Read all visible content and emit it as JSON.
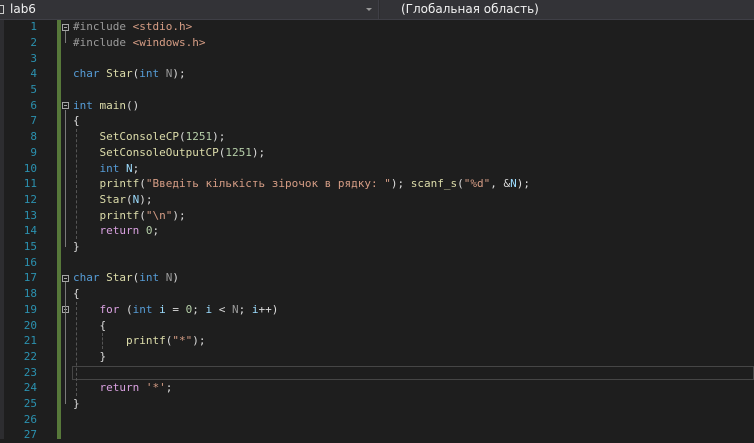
{
  "toolbar": {
    "file_combo": "lab6",
    "scope_combo": "(Глобальная область)"
  },
  "colors": {
    "kw": "#569cd6",
    "fn": "#dcdcaa",
    "str": "#d69d85",
    "pp": "#9b9b9b",
    "param": "#9a9a9a",
    "var": "#9cdcfe",
    "ctl": "#d8a0df",
    "num": "#b5cea8",
    "def": "#dcdcdc",
    "linenum": "#2b91af",
    "changebar": "#57783a"
  },
  "editor": {
    "current_line": 23,
    "fold_lines": [
      1,
      6,
      17,
      19
    ],
    "lines": [
      [
        [
          "pp",
          "#include "
        ],
        [
          "str",
          "<stdio.h>"
        ]
      ],
      [
        [
          "pp",
          "#include "
        ],
        [
          "str",
          "<windows.h>"
        ]
      ],
      [],
      [
        [
          "kw",
          "char "
        ],
        [
          "fn",
          "Star"
        ],
        [
          "def",
          "("
        ],
        [
          "kw",
          "int "
        ],
        [
          "param",
          "N"
        ],
        [
          "def",
          ");"
        ]
      ],
      [],
      [
        [
          "kw",
          "int "
        ],
        [
          "fn",
          "main"
        ],
        [
          "def",
          "()"
        ]
      ],
      [
        [
          "def",
          "{"
        ]
      ],
      [
        [
          "def",
          "    "
        ],
        [
          "fn",
          "SetConsoleCP"
        ],
        [
          "def",
          "("
        ],
        [
          "num",
          "1251"
        ],
        [
          "def",
          ");"
        ]
      ],
      [
        [
          "def",
          "    "
        ],
        [
          "fn",
          "SetConsoleOutputCP"
        ],
        [
          "def",
          "("
        ],
        [
          "num",
          "1251"
        ],
        [
          "def",
          ");"
        ]
      ],
      [
        [
          "def",
          "    "
        ],
        [
          "kw",
          "int "
        ],
        [
          "var",
          "N"
        ],
        [
          "def",
          ";"
        ]
      ],
      [
        [
          "def",
          "    "
        ],
        [
          "fn",
          "printf"
        ],
        [
          "def",
          "("
        ],
        [
          "str",
          "\"Введіть кількість зірочок в рядку: \""
        ],
        [
          "def",
          "); "
        ],
        [
          "fn",
          "scanf_s"
        ],
        [
          "def",
          "("
        ],
        [
          "str",
          "\"%d\""
        ],
        [
          "def",
          ", &"
        ],
        [
          "var",
          "N"
        ],
        [
          "def",
          ");"
        ]
      ],
      [
        [
          "def",
          "    "
        ],
        [
          "fn",
          "Star"
        ],
        [
          "def",
          "("
        ],
        [
          "var",
          "N"
        ],
        [
          "def",
          ");"
        ]
      ],
      [
        [
          "def",
          "    "
        ],
        [
          "fn",
          "printf"
        ],
        [
          "def",
          "("
        ],
        [
          "str",
          "\"\\n\""
        ],
        [
          "def",
          ");"
        ]
      ],
      [
        [
          "def",
          "    "
        ],
        [
          "ctl",
          "return "
        ],
        [
          "num",
          "0"
        ],
        [
          "def",
          ";"
        ]
      ],
      [
        [
          "def",
          "}"
        ]
      ],
      [],
      [
        [
          "kw",
          "char "
        ],
        [
          "fn",
          "Star"
        ],
        [
          "def",
          "("
        ],
        [
          "kw",
          "int "
        ],
        [
          "param",
          "N"
        ],
        [
          "def",
          ")"
        ]
      ],
      [
        [
          "def",
          "{"
        ]
      ],
      [
        [
          "def",
          "    "
        ],
        [
          "ctl",
          "for "
        ],
        [
          "def",
          "("
        ],
        [
          "kw",
          "int "
        ],
        [
          "var",
          "i"
        ],
        [
          "def",
          " = "
        ],
        [
          "num",
          "0"
        ],
        [
          "def",
          "; "
        ],
        [
          "var",
          "i"
        ],
        [
          "def",
          " < "
        ],
        [
          "param",
          "N"
        ],
        [
          "def",
          "; "
        ],
        [
          "var",
          "i"
        ],
        [
          "def",
          "++)"
        ]
      ],
      [
        [
          "def",
          "    {"
        ]
      ],
      [
        [
          "def",
          "        "
        ],
        [
          "fn",
          "printf"
        ],
        [
          "def",
          "("
        ],
        [
          "str",
          "\"*\""
        ],
        [
          "def",
          ");"
        ]
      ],
      [
        [
          "def",
          "    }"
        ]
      ],
      [],
      [
        [
          "def",
          "    "
        ],
        [
          "ctl",
          "return "
        ],
        [
          "str",
          "'*'"
        ],
        [
          "def",
          ";"
        ]
      ],
      [
        [
          "def",
          "}"
        ]
      ],
      [],
      []
    ]
  }
}
